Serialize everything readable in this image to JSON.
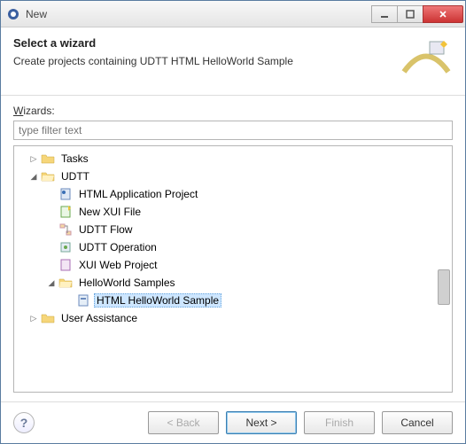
{
  "window": {
    "title": "New"
  },
  "header": {
    "heading": "Select a wizard",
    "description": "Create projects containing UDTT HTML HelloWorld Sample"
  },
  "wizards_label": "Wizards:",
  "filter_placeholder": "type filter text",
  "tree": {
    "tasks": "Tasks",
    "udtt": "UDTT",
    "html_app_project": "HTML Application Project",
    "new_xui_file": "New XUI File",
    "udtt_flow": "UDTT Flow",
    "udtt_operation": "UDTT Operation",
    "xui_web_project": "XUI Web Project",
    "helloworld_samples": "HelloWorld Samples",
    "html_helloworld_sample": "HTML HelloWorld Sample",
    "user_assistance": "User Assistance"
  },
  "buttons": {
    "back": "< Back",
    "next": "Next >",
    "finish": "Finish",
    "cancel": "Cancel"
  }
}
